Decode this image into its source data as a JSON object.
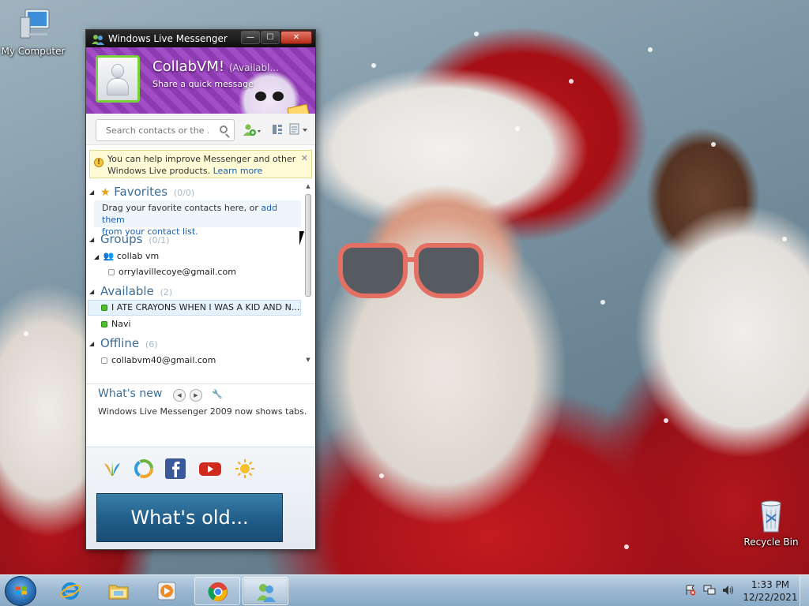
{
  "desktop": {
    "icons": [
      {
        "label": "My Computer",
        "icon": "computer-icon"
      },
      {
        "label": "Recycle Bin",
        "icon": "recycle-bin-icon"
      }
    ]
  },
  "messenger": {
    "title": "Windows Live Messenger",
    "controls": {
      "minimize": "—",
      "maximize": "☐",
      "close": "✕"
    },
    "profile": {
      "name": "CollabVM!",
      "status": "(Availabl...",
      "quick_message": "Share a quick message"
    },
    "search": {
      "placeholder": "Search contacts or the ..."
    },
    "info_bar": {
      "text": "You can help improve Messenger and other Windows Live products.",
      "link": "Learn more",
      "close": "✕"
    },
    "favorites": {
      "label": "Favorites",
      "count": "(0/0)",
      "desc_text": "Drag your favorite contacts here, or ",
      "desc_link1": "add them",
      "desc_link2": "from your contact list."
    },
    "groups": {
      "label": "Groups",
      "count": "(0/1)",
      "subgroup": "collab vm",
      "members": [
        "orrylavillecoye@gmail.com"
      ]
    },
    "available": {
      "label": "Available",
      "count": "(2)",
      "contacts": [
        "I ATE CRAYONS WHEN I WAS A KID AND N...",
        "Navi"
      ]
    },
    "offline": {
      "label": "Offline",
      "count": "(6)",
      "contacts": [
        "collabvm40@gmail.com"
      ]
    },
    "whats_new": {
      "title": "What's new",
      "text": "Windows Live Messenger 2009 now shows tabs."
    },
    "services": [
      "windows-live-icon",
      "messenger-swirl-icon",
      "facebook-icon",
      "youtube-icon",
      "weather-sun-icon"
    ],
    "banner": "What's old..."
  },
  "taskbar": {
    "items": [
      "internet-explorer-icon",
      "windows-explorer-icon",
      "media-player-icon",
      "chrome-icon",
      "messenger-icon"
    ],
    "clock": {
      "time": "1:33 PM",
      "date": "12/22/2021"
    }
  },
  "colors": {
    "profile_bg": "#9a46c0",
    "group_header": "#3c6d96",
    "online": "#4fbf2c",
    "taskbar": "#9db9d3"
  }
}
